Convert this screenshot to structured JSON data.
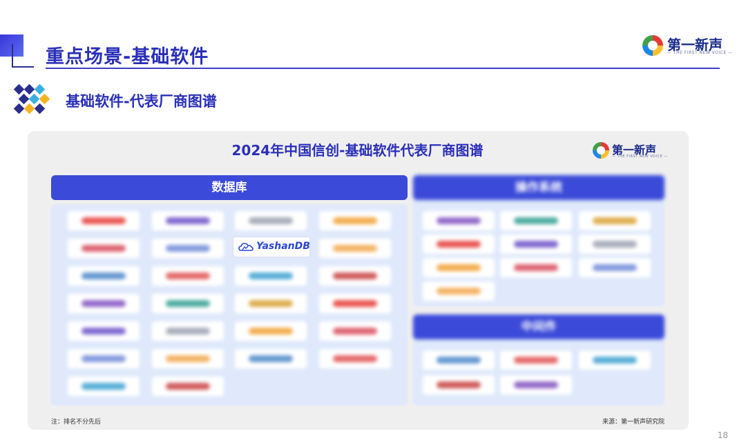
{
  "header": {
    "title": "重点场景-基础软件",
    "subtitle": "基础软件-代表厂商图谱"
  },
  "brand": {
    "name_cn": "第一新声",
    "name_en": "— THE FIRST NEW VOICE —"
  },
  "card": {
    "title": "2024年中国信创-基础软件代表厂商图谱",
    "categories": [
      {
        "label": "数据库",
        "highlighted": true
      },
      {
        "label": "操作系统",
        "highlighted": false
      },
      {
        "label": "中间件",
        "highlighted": false
      }
    ],
    "highlighted_vendor": "YashanDB",
    "footnote": "注：排名不分先后",
    "source": "来源：第一新声研究院"
  },
  "colors": {
    "accent": "#2a2fb8",
    "header_bar": "#3b4ad8",
    "panel_bg": "#dfe9fb"
  },
  "page": {
    "number": "18"
  }
}
